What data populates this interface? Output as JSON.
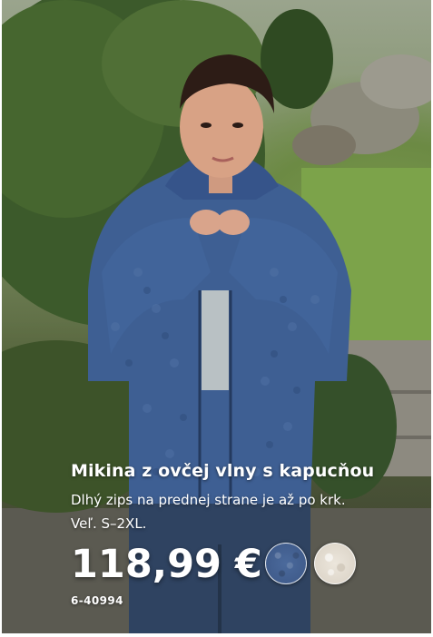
{
  "product": {
    "title": "Mikina z ovčej vlny s kapucňou",
    "description": "Dlhý zips na prednej strane je až po krk.",
    "sizes": "Veľ. S–2XL.",
    "price": "118,99 €",
    "code": "6-40994",
    "color_options": [
      {
        "name": "blue-swatch",
        "color": "#4b6a9c"
      },
      {
        "name": "cream-swatch",
        "color": "#e6dfd4"
      }
    ]
  },
  "colors": {
    "text": "#ffffff",
    "jacket": "#3e5f93",
    "hedge": "#3f5a2a",
    "lawn": "#7aa04a"
  }
}
